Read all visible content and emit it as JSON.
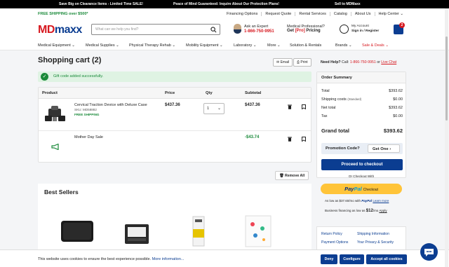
{
  "topbar": {
    "promo1": "Save Big on Clearance Items - Limited Time SALE!",
    "promo2": "Peace of Mind Guaranteed: Inquire About Our Protection Plans!",
    "promo3": "Sell to MDMaxx"
  },
  "utility": {
    "free_shipping": "FREE SHIPPING over $500*",
    "links": [
      "Financing Options",
      "Request Quote",
      "Rental Services",
      "Catalog",
      "About Us",
      "Help Center"
    ]
  },
  "header": {
    "logo_md": "MD",
    "logo_maxx": "maxx",
    "search_placeholder": "What can we help you find?",
    "expert_title": "Ask an Expert",
    "expert_phone": "1-866-750-9951",
    "prof_title": "Medical Professional?",
    "prof_get": "Get",
    "prof_pro": "[Pro]",
    "prof_pricing": "Pricing",
    "account_title": "My Account",
    "account_signin": "Sign in / Register",
    "cart_count": "2"
  },
  "nav": {
    "items": [
      "Medical Equipment",
      "Medical Supplies",
      "Physical Therapy Rehab",
      "Mobility Equipment",
      "Laboratory",
      "More",
      "Solution & Rentals",
      "Brands",
      "Sale & Deals"
    ]
  },
  "cart": {
    "title": "Shopping cart (2)",
    "email_label": "Email",
    "print_label": "Print",
    "alert": "Gift code added successfully.",
    "columns": [
      "Product",
      "Price",
      "Qty",
      "Subtotal"
    ],
    "item1": {
      "name": "Cervical Traction Device with Deluxe Case",
      "sku": "SKU: MD58882",
      "shipping": "FREE SHIPPING",
      "price": "$437.36",
      "qty": "1",
      "subtotal": "$437.36"
    },
    "item2": {
      "name": "Mother Day Sale",
      "discount": "-$43.74"
    },
    "remove_all": "Remove All"
  },
  "best_sellers": {
    "title": "Best Sellers"
  },
  "help": {
    "label": "Need Help?",
    "call": "Call:",
    "phone": "1-866-750-9951",
    "or": "or",
    "chat": "Live Chat"
  },
  "summary": {
    "title": "Order Summary",
    "total_label": "Total",
    "total": "$393.62",
    "shipping_label": "Shipping costs",
    "shipping_note": "(Standard)",
    "shipping": "$0.00",
    "net_label": "Net total",
    "net": "$393.62",
    "tax_label": "Tax",
    "tax": "$0.00",
    "grand_label": "Grand total",
    "grand": "$393.62",
    "promo_q": "Promotion Code?",
    "promo_btn": "Get One",
    "checkout": "Proceed to checkout"
  },
  "paypal": {
    "or_label": "Or Checkout With",
    "pay": "Pay",
    "pal": "Pal",
    "checkout": "Checkout",
    "as_low": "As low as $37.60/mo with",
    "pp_word": "PayPal",
    "learn": "Learn more",
    "biz1": "Business financing as low as",
    "biz_amt": "$12",
    "biz2": "/mo",
    "apply": "Apply"
  },
  "footer_links": [
    "Return Policy",
    "Shipping Information",
    "Payment Options",
    "Your Privacy & Security"
  ],
  "cookie": {
    "msg": "This website uses cookies to ensure the best experience possible.",
    "more": "More information...",
    "deny": "Deny",
    "configure": "Configure",
    "accept": "Accept all cookies"
  },
  "colors": {
    "brand_red": "#d71920",
    "brand_blue": "#0b3d91",
    "success_green": "#1a8a3a",
    "paypal_yellow": "#ffc439"
  }
}
